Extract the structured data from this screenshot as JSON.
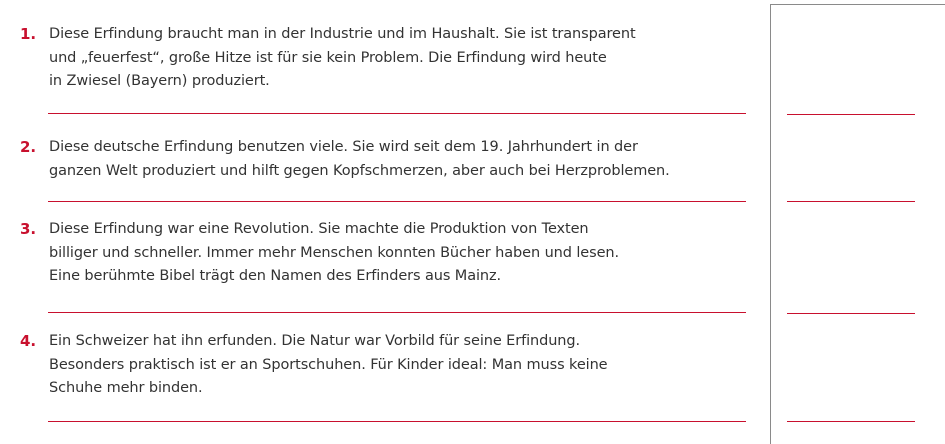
{
  "items": [
    {
      "number": "1.",
      "lines": [
        "Diese Erfindung braucht man in der Industrie und im Haushalt. Sie ist transparent",
        "und „feuerfest“, große Hitze ist für sie kein Problem. Die Erfindung wird heute",
        "in Zwiesel (Bayern) produziert."
      ]
    },
    {
      "number": "2.",
      "lines": [
        "Diese deutsche Erfindung benutzen viele. Sie wird seit dem 19. Jahrhundert in der",
        "ganzen Welt produziert und hilft gegen Kopfschmerzen, aber auch bei Herzproblemen."
      ]
    },
    {
      "number": "3.",
      "lines": [
        "Diese Erfindung war eine Revolution. Sie machte die Produktion von Texten",
        "billiger und schneller. Immer mehr Menschen konnten Bücher haben und lesen.",
        "Eine berühmte Bibel trägt den Namen des Erfinders aus Mainz."
      ]
    },
    {
      "number": "4.",
      "lines": [
        "Ein Schweizer hat ihn erfunden. Die Natur war Vorbild für seine Erfindung.",
        "Besonders praktisch ist er an Sportschuhen. Für Kinder ideal: Man muss keine",
        "Schuhe mehr binden."
      ]
    }
  ],
  "colors": {
    "accent": "#c8102e",
    "text": "#333333",
    "border": "#8a8a8a"
  }
}
